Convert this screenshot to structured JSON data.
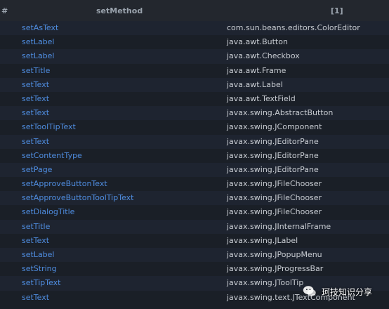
{
  "header": {
    "hash_label": "#",
    "method_label": "setMethod",
    "index_label": "[1]"
  },
  "rows": [
    {
      "method": "setAsText",
      "cls": "com.sun.beans.editors.ColorEditor"
    },
    {
      "method": "setLabel",
      "cls": "java.awt.Button"
    },
    {
      "method": "setLabel",
      "cls": "java.awt.Checkbox"
    },
    {
      "method": "setTitle",
      "cls": "java.awt.Frame"
    },
    {
      "method": "setText",
      "cls": "java.awt.Label"
    },
    {
      "method": "setText",
      "cls": "java.awt.TextField"
    },
    {
      "method": "setText",
      "cls": "javax.swing.AbstractButton"
    },
    {
      "method": "setToolTipText",
      "cls": "javax.swing.JComponent"
    },
    {
      "method": "setText",
      "cls": "javax.swing.JEditorPane"
    },
    {
      "method": "setContentType",
      "cls": "javax.swing.JEditorPane"
    },
    {
      "method": "setPage",
      "cls": "javax.swing.JEditorPane"
    },
    {
      "method": "setApproveButtonText",
      "cls": "javax.swing.JFileChooser"
    },
    {
      "method": "setApproveButtonToolTipText",
      "cls": "javax.swing.JFileChooser"
    },
    {
      "method": "setDialogTitle",
      "cls": "javax.swing.JFileChooser"
    },
    {
      "method": "setTitle",
      "cls": "javax.swing.JInternalFrame"
    },
    {
      "method": "setText",
      "cls": "javax.swing.JLabel"
    },
    {
      "method": "setLabel",
      "cls": "javax.swing.JPopupMenu"
    },
    {
      "method": "setString",
      "cls": "javax.swing.JProgressBar"
    },
    {
      "method": "setTipText",
      "cls": "javax.swing.JToolTip"
    },
    {
      "method": "setText",
      "cls": "javax.swing.text.JTextComponent"
    }
  ],
  "watermark": {
    "text": "珂技知识分享",
    "icon": "wechat-logo-icon"
  }
}
